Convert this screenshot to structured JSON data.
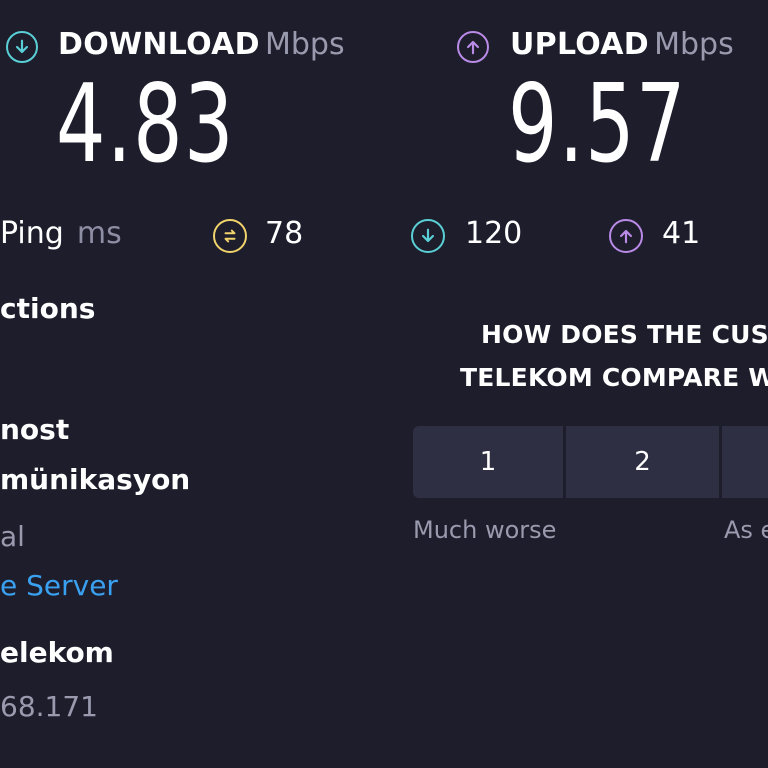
{
  "download": {
    "label": "DOWNLOAD",
    "unit": "Mbps",
    "value": "4.83",
    "icon": "arrow-down-circle-icon",
    "color": "#5ad0d6"
  },
  "upload": {
    "label": "UPLOAD",
    "unit": "Mbps",
    "value": "9.57",
    "icon": "arrow-up-circle-icon",
    "color": "#b98ae6"
  },
  "ping": {
    "label": "Ping",
    "unit": "ms",
    "unloaded_value": "78",
    "download_value": "120",
    "upload_value": "41",
    "unloaded_color": "#f1d36b"
  },
  "sidebar": {
    "connections_label": "ctions",
    "host_label": "nost",
    "provider_name": "münikasyon",
    "provider_sub": "al",
    "change_server_link": "e Server",
    "server_name": "elekom",
    "ip_address": "68.171"
  },
  "survey": {
    "question_line1": "HOW DOES THE CUST",
    "question_line2": "TELEKOM COMPARE W",
    "options": [
      "1",
      "2",
      ""
    ],
    "low_label": "Much worse",
    "mid_label": "As e"
  },
  "colors": {
    "background": "#1d1d2c",
    "panel": "#2f2f43",
    "link": "#3aa0f0",
    "muted": "#9a9aae"
  }
}
